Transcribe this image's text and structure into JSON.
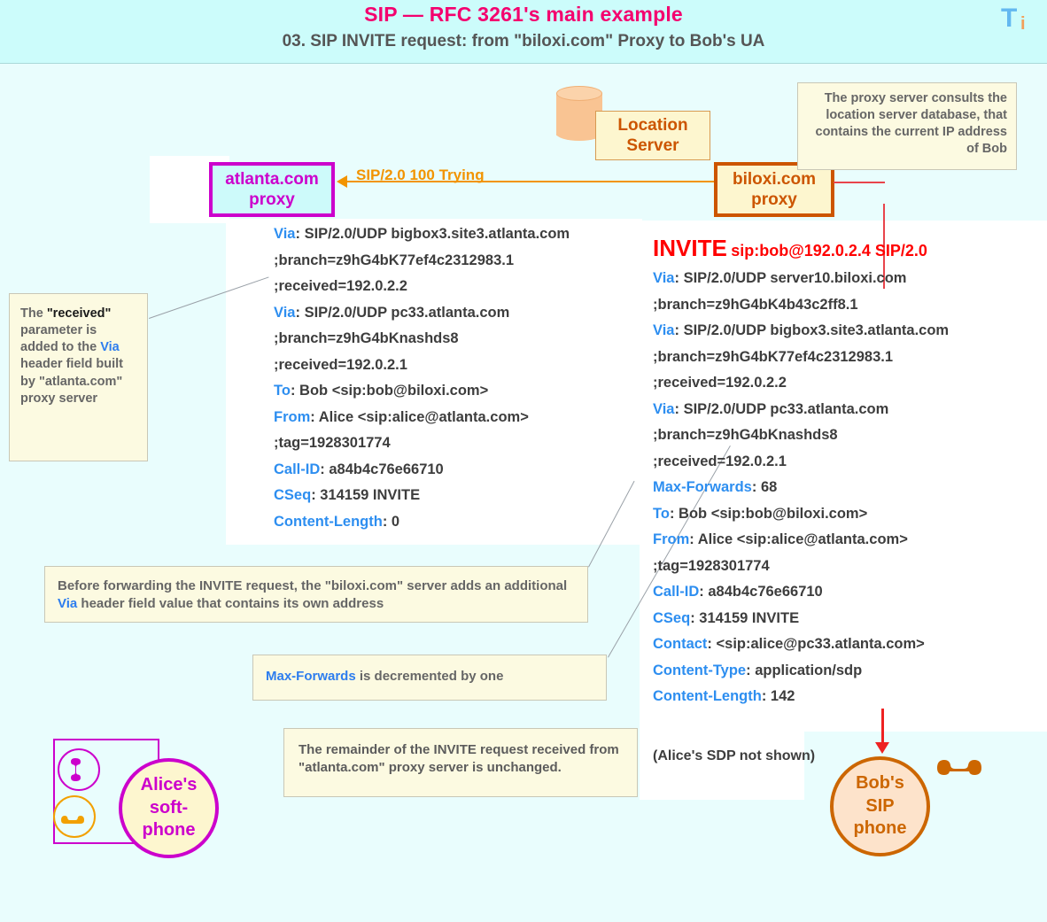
{
  "header": {
    "title": "SIP — RFC 3261's main example",
    "subtitle": "03.  SIP INVITE request: from \"biloxi.com\" Proxy to Bob's UA",
    "logo_t": "T",
    "logo_i": "i"
  },
  "nodes": {
    "atlanta_proxy_line1": "atlanta.com",
    "atlanta_proxy_line2": "proxy",
    "biloxi_proxy_line1": "biloxi.com",
    "biloxi_proxy_line2": "proxy",
    "location_server_line1": "Location",
    "location_server_line2": "Server"
  },
  "arrows": {
    "trying_label": "SIP/2.0 100 Trying"
  },
  "callouts": {
    "proxy_consults": "The proxy server consults the location server database, that contains the current IP address of Bob",
    "received_param": {
      "p1": "The ",
      "p2": "\"received\"",
      "p3": " parameter is added to the ",
      "p4": "Via",
      "p5": " header field built by \"atlanta.com\" proxy server"
    },
    "before_forwarding": {
      "p1": "Before forwarding the INVITE request, the \"biloxi.com\" server adds an additional ",
      "p2": "Via",
      "p3": " header field value that contains its own address"
    },
    "max_forwards": {
      "p1": "Max-Forwards",
      "p2": " is decremented by one"
    },
    "remainder": "The remainder of the INVITE request received from \"atlanta.com\" proxy server is unchanged."
  },
  "left_message": {
    "lines": [
      {
        "header": "Via",
        "sep": ": ",
        "value": "SIP/2.0/UDP bigbox3.site3.atlanta.com"
      },
      {
        "header": "",
        "sep": "",
        "value": " ;branch=z9hG4bK77ef4c2312983.1"
      },
      {
        "header": "",
        "sep": "",
        "value": " ;received=192.0.2.2"
      },
      {
        "header": "Via",
        "sep": ": ",
        "value": "SIP/2.0/UDP pc33.atlanta.com"
      },
      {
        "header": "",
        "sep": "",
        "value": " ;branch=z9hG4bKnashds8"
      },
      {
        "header": "",
        "sep": "",
        "value": " ;received=192.0.2.1"
      },
      {
        "header": "To",
        "sep": ": ",
        "value": "Bob <sip:bob@biloxi.com>"
      },
      {
        "header": "From",
        "sep": ": ",
        "value": "Alice <sip:alice@atlanta.com>"
      },
      {
        "header": "",
        "sep": "",
        "value": " ;tag=1928301774"
      },
      {
        "header": "Call-ID",
        "sep": ": ",
        "value": "a84b4c76e66710"
      },
      {
        "header": "CSeq",
        "sep": ": ",
        "value": "314159 INVITE"
      },
      {
        "header": "Content-Length",
        "sep": ": ",
        "value": "0"
      }
    ]
  },
  "right_message": {
    "request_line_method": "INVITE",
    "request_line_uri": "sip:bob@192.0.2.4 SIP/2.0",
    "lines": [
      {
        "header": "Via",
        "sep": ": ",
        "value": "SIP/2.0/UDP server10.biloxi.com"
      },
      {
        "header": "",
        "sep": "",
        "value": " ;branch=z9hG4bK4b43c2ff8.1"
      },
      {
        "header": "Via",
        "sep": ": ",
        "value": "SIP/2.0/UDP bigbox3.site3.atlanta.com"
      },
      {
        "header": "",
        "sep": "",
        "value": " ;branch=z9hG4bK77ef4c2312983.1"
      },
      {
        "header": "",
        "sep": "",
        "value": " ;received=192.0.2.2"
      },
      {
        "header": "Via",
        "sep": ": ",
        "value": "SIP/2.0/UDP pc33.atlanta.com"
      },
      {
        "header": "",
        "sep": "",
        "value": " ;branch=z9hG4bKnashds8"
      },
      {
        "header": "",
        "sep": "",
        "value": " ;received=192.0.2.1"
      },
      {
        "header": "Max-Forwards",
        "sep": ": ",
        "value": "68"
      },
      {
        "header": "To",
        "sep": ": ",
        "value": "Bob <sip:bob@biloxi.com>"
      },
      {
        "header": "From",
        "sep": ": ",
        "value": "Alice <sip:alice@atlanta.com>"
      },
      {
        "header": "",
        "sep": "",
        "value": " ;tag=1928301774"
      },
      {
        "header": "Call-ID",
        "sep": ": ",
        "value": "a84b4c76e66710"
      },
      {
        "header": "CSeq",
        "sep": ": ",
        "value": "314159 INVITE"
      },
      {
        "header": "Contact",
        "sep": ": ",
        "value": "<sip:alice@pc33.atlanta.com>"
      },
      {
        "header": "Content-Type",
        "sep": ": ",
        "value": "application/sdp"
      },
      {
        "header": "Content-Length",
        "sep": ": ",
        "value": "142"
      }
    ],
    "sdp_note": "(Alice's SDP not shown)"
  },
  "endpoints": {
    "alice": "Alice's soft-phone",
    "alice_l1": "Alice's",
    "alice_l2": "soft-",
    "alice_l3": "phone",
    "bob_l1": "Bob's",
    "bob_l2": "SIP",
    "bob_l3": "phone"
  },
  "colors": {
    "page_bg": "#e9fdfd",
    "header_bg": "#ccfcfb",
    "title_pink": "#f4006e",
    "subtitle_gray": "#555555",
    "magenta": "#cc00cc",
    "orange": "#cc5500",
    "header_blue": "#2d8ef0",
    "red": "#ff0000",
    "callout_bg": "#fcfae1",
    "arrow_orange": "#f29400"
  }
}
